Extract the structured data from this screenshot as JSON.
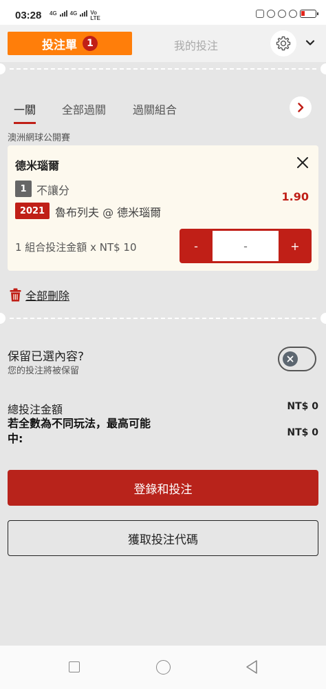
{
  "status_bar": {
    "time": "03:28",
    "net1": "4G",
    "net2": "4G",
    "volte_top": "Vo",
    "volte_bottom": "LTE"
  },
  "header": {
    "betslip_tab": "投注單",
    "betslip_count": "1",
    "mybets_tab": "我的投注"
  },
  "bet_type_tabs": [
    "一關",
    "全部過關",
    "過關組合"
  ],
  "league": "澳洲網球公開賽",
  "bet": {
    "selection": "德米瑙爾",
    "market_code": "1",
    "market": "不讓分",
    "odds": "1.90",
    "event_code": "2021",
    "event": "魯布列夫 @ 德米瑙爾",
    "combo_text": "1 組合投注金額 x NT$ 10",
    "stake": {
      "minus": "-",
      "value": "-",
      "plus": "+"
    }
  },
  "delete_all": "全部刪除",
  "retain": {
    "title": "保留已選內容?",
    "subtitle": "您的投注將被保留"
  },
  "totals": {
    "total_label": "總投注金額",
    "total_value": "NT$ 0",
    "max_win_label": "若全數為不同玩法，最高可能中:",
    "max_win_value": "NT$ 0"
  },
  "buttons": {
    "login_bet": "登錄和投注",
    "get_code": "獲取投注代碼"
  },
  "colors": {
    "accent_orange": "#ff7e0a",
    "brand_red": "#c01f17",
    "button_red": "#b8231b",
    "background": "#e6e6e6",
    "card": "#fdf9ee"
  },
  "icons": [
    "gear-icon",
    "chevron-down-icon",
    "chevron-right-icon",
    "close-icon",
    "trash-icon",
    "toggle-x-icon"
  ]
}
